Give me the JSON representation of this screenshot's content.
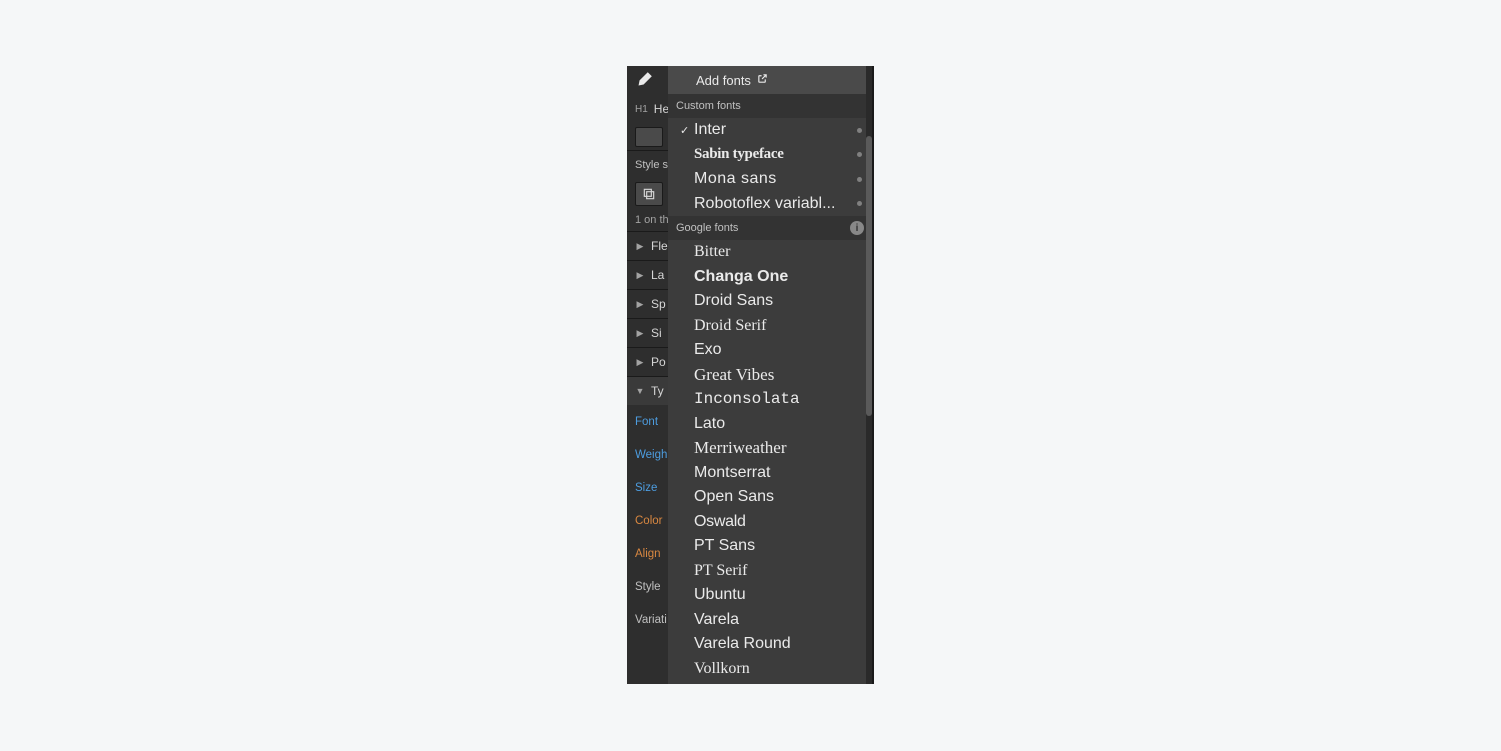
{
  "sidebar": {
    "tag": "H1",
    "tag_text": "He",
    "style_selector_label": "Style s",
    "hint_text": "1 on th",
    "accordion": [
      {
        "label": "Fle",
        "open": false
      },
      {
        "label": "La",
        "open": false
      },
      {
        "label": "Sp",
        "open": false
      },
      {
        "label": "Si",
        "open": false
      },
      {
        "label": "Po",
        "open": false
      },
      {
        "label": "Ty",
        "open": true
      }
    ],
    "typography_rows": [
      {
        "label": "Font",
        "color": "blue"
      },
      {
        "label": "Weigh",
        "color": "blue"
      },
      {
        "label": "Size",
        "color": "blue"
      },
      {
        "label": "Color",
        "color": "orange"
      },
      {
        "label": "Align",
        "color": "orange"
      },
      {
        "label": "Style",
        "color": "gray"
      },
      {
        "label": "Variati",
        "color": "gray"
      }
    ]
  },
  "dropdown": {
    "add_label": "Add fonts",
    "custom_header": "Custom fonts",
    "google_header": "Google fonts",
    "custom_fonts": [
      {
        "name": "Inter",
        "selected": true,
        "cls": "f-inter",
        "dot": true
      },
      {
        "name": "Sabin typeface",
        "selected": false,
        "cls": "f-blackletter",
        "dot": true
      },
      {
        "name": "Mona sans",
        "selected": false,
        "cls": "f-mona",
        "dot": true
      },
      {
        "name": "Robotoflex variabl...",
        "selected": false,
        "cls": "f-roboto",
        "dot": true
      }
    ],
    "google_fonts": [
      {
        "name": "Bitter",
        "cls": "f-bitter"
      },
      {
        "name": "Changa One",
        "cls": "f-changa"
      },
      {
        "name": "Droid Sans",
        "cls": "f-droidsans"
      },
      {
        "name": "Droid Serif",
        "cls": "f-droidserif"
      },
      {
        "name": "Exo",
        "cls": "f-exo"
      },
      {
        "name": "Great Vibes",
        "cls": "f-greatvibes"
      },
      {
        "name": "Inconsolata",
        "cls": "f-inconsolata"
      },
      {
        "name": "Lato",
        "cls": "f-lato"
      },
      {
        "name": "Merriweather",
        "cls": "f-merri"
      },
      {
        "name": "Montserrat",
        "cls": "f-montserrat"
      },
      {
        "name": "Open Sans",
        "cls": "f-opensans"
      },
      {
        "name": "Oswald",
        "cls": "f-oswald"
      },
      {
        "name": "PT Sans",
        "cls": "f-ptsans"
      },
      {
        "name": "PT Serif",
        "cls": "f-ptserif"
      },
      {
        "name": "Ubuntu",
        "cls": "f-ubuntu"
      },
      {
        "name": "Varela",
        "cls": "f-varela"
      },
      {
        "name": "Varela Round",
        "cls": "f-varelar"
      },
      {
        "name": "Vollkorn",
        "cls": "f-vollkorn"
      }
    ]
  }
}
